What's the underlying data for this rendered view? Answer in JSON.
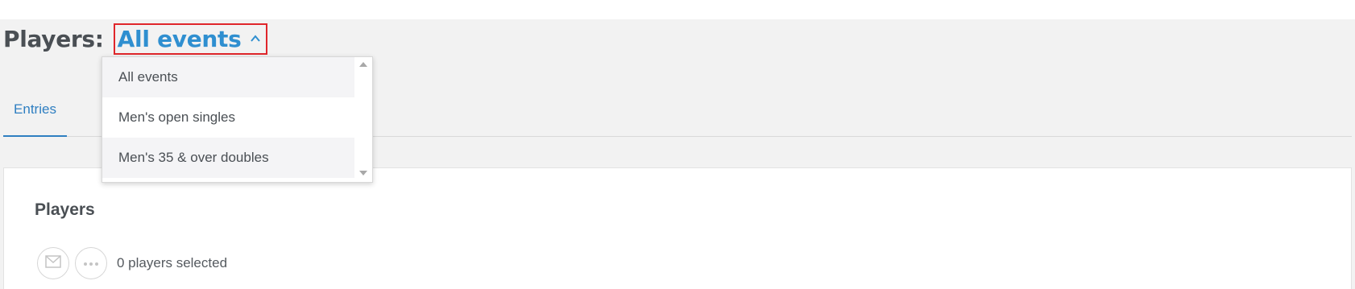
{
  "header": {
    "prefix": "Players:",
    "selected_event": "All events"
  },
  "tabs": [
    {
      "label": "Entries"
    }
  ],
  "card": {
    "title": "Players",
    "selected_count_text": "0 players selected"
  },
  "dropdown": {
    "options": [
      {
        "label": "All events"
      },
      {
        "label": "Men's open singles"
      },
      {
        "label": "Men's 35 & over doubles"
      }
    ]
  },
  "icons": {
    "caret": "chevron-up-icon",
    "mail": "mail-icon",
    "more": "more-horizontal-icon",
    "scroll_up": "scroll-up-arrow",
    "scroll_down": "scroll-down-arrow"
  },
  "colors": {
    "accent": "#2f8fd0",
    "tab_active": "#2f7fc1",
    "highlight_border": "#e0262b",
    "page_background": "#f2f2f2"
  }
}
